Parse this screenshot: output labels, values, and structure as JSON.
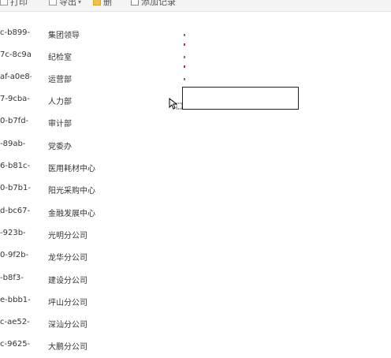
{
  "toolbar": {
    "items": [
      {
        "label": "打印",
        "icon": "print-icon",
        "has_caret": false
      },
      {
        "label": "导出",
        "icon": "export-icon",
        "has_caret": true
      },
      {
        "label": "删",
        "icon": "folder-icon",
        "has_caret": false
      },
      {
        "label": "添加记录",
        "icon": "list-icon",
        "has_caret": false
      }
    ]
  },
  "table": {
    "rows": [
      {
        "id": "c-b899-",
        "name": "集团领导"
      },
      {
        "id": "7c-8c9a-",
        "name": "纪检室"
      },
      {
        "id": "af-a0e8-",
        "name": "运营部"
      },
      {
        "id": "7-9cba-",
        "name": "人力部"
      },
      {
        "id": "0-b7fd-",
        "name": "审计部"
      },
      {
        "id": "-89ab-",
        "name": "党委办"
      },
      {
        "id": "6-b81c-",
        "name": "医用耗材中心"
      },
      {
        "id": "0-b7b1-",
        "name": "阳光采购中心"
      },
      {
        "id": "d-bc67-",
        "name": "金融发展中心"
      },
      {
        "id": "-923b-",
        "name": "光明分公司"
      },
      {
        "id": "0-9f2b-",
        "name": "龙华分公司"
      },
      {
        "id": "-b8f3-",
        "name": "建设分公司"
      },
      {
        "id": "e-bbb1-",
        "name": "坪山分公司"
      },
      {
        "id": "c-ae52-",
        "name": "深汕分公司"
      },
      {
        "id": "c-9625-",
        "name": "大鹏分公司"
      }
    ]
  },
  "editor": {
    "value": ""
  },
  "colors": {
    "marker_red": "#d22222",
    "marker_gray": "#777777"
  }
}
